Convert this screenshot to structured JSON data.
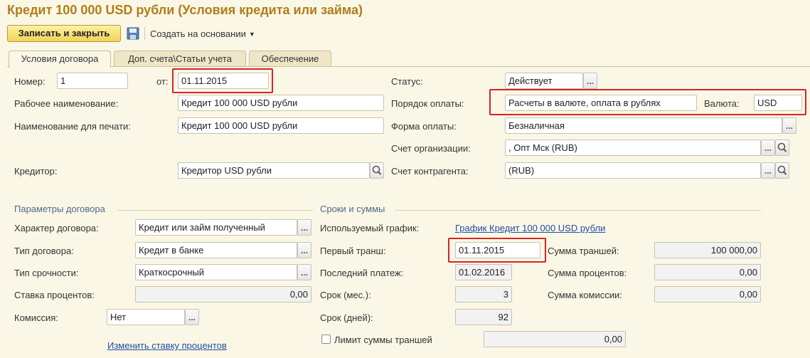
{
  "window": {
    "title": "Кредит 100 000 USD рубли (Условия кредита или займа)"
  },
  "toolbar": {
    "save_close_label": "Записать и закрыть",
    "create_based_label": "Создать на основании",
    "save_icon": "floppy-disk-icon"
  },
  "tabs": [
    {
      "label": "Условия договора",
      "active": true
    },
    {
      "label": "Доп. счета\\Статьи учета",
      "active": false
    },
    {
      "label": "Обеспечение",
      "active": false
    }
  ],
  "header": {
    "number_label": "Номер:",
    "number_value": "1",
    "from_label": "от:",
    "from_value": "01.11.2015",
    "work_name_label": "Рабочее наименование:",
    "work_name_value": "Кредит 100 000 USD рубли",
    "print_name_label": "Наименование для печати:",
    "print_name_value": "Кредит 100 000 USD рубли",
    "creditor_label": "Кредитор:",
    "creditor_value": "Кредитор USD рубли",
    "status_label": "Статус:",
    "status_value": "Действует",
    "payment_order_label": "Порядок оплаты:",
    "payment_order_value": "Расчеты в валюте, оплата в рублях",
    "currency_label": "Валюта:",
    "currency_value": "USD",
    "payment_form_label": "Форма оплаты:",
    "payment_form_value": "Безналичная",
    "org_account_label": "Счет организации:",
    "org_account_value": ", Опт Мск (RUB)",
    "counterparty_account_label": "Счет контрагента:",
    "counterparty_account_value": "(RUB)"
  },
  "contract_params": {
    "section_title": "Параметры договора",
    "nature_label": "Характер договора:",
    "nature_value": "Кредит или займ полученный",
    "type_label": "Тип договора:",
    "type_value": "Кредит в банке",
    "term_type_label": "Тип срочности:",
    "term_type_value": "Краткосрочный",
    "rate_label": "Ставка процентов:",
    "rate_value": "0,00",
    "commission_label": "Комиссия:",
    "commission_value": "Нет",
    "change_rate_link": "Изменить ставку процентов"
  },
  "terms": {
    "section_title": "Сроки и суммы",
    "schedule_label": "Используемый график:",
    "schedule_link": "График Кредит 100 000 USD рубли",
    "first_tranche_label": "Первый транш:",
    "first_tranche_value": "01.11.2015",
    "last_payment_label": "Последний платеж:",
    "last_payment_value": "01.02.2016",
    "term_months_label": "Срок (мес.):",
    "term_months_value": "3",
    "term_days_label": "Срок (дней):",
    "term_days_value": "92",
    "tranche_limit_label": "Лимит суммы траншей",
    "tranche_limit_checked": false,
    "tranche_limit_value": "0,00",
    "tranche_sum_label": "Сумма траншей:",
    "tranche_sum_value": "100 000,00",
    "interest_sum_label": "Сумма процентов:",
    "interest_sum_value": "0,00",
    "commission_sum_label": "Сумма комиссии:",
    "commission_sum_value": "0,00"
  },
  "colors": {
    "highlight": "#d62525",
    "title": "#b07d1a",
    "link": "#1f4ea3"
  }
}
